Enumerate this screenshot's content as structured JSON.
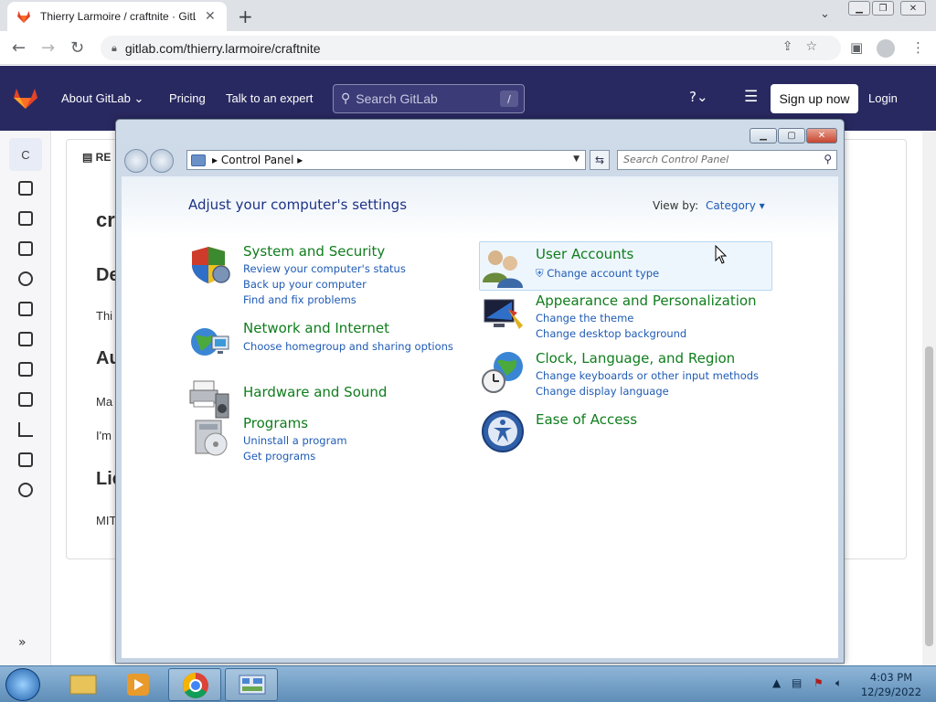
{
  "browser": {
    "tab_title": "Thierry Larmoire / craftnite · GitL",
    "url": "gitlab.com/thierry.larmoire/craftnite"
  },
  "gitlab": {
    "nav": {
      "about": "About GitLab",
      "pricing": "Pricing",
      "talk": "Talk to an expert",
      "search_placeholder": "Search GitLab",
      "search_shortcut": "/",
      "signup": "Sign up now",
      "login": "Login"
    },
    "project_avatar_letter": "C",
    "content_fragments": {
      "readme": "RE",
      "title": "cr",
      "h_description": "De",
      "p_description": "Thi",
      "h_authors": "Au",
      "p_authors_1": "Ma",
      "p_authors_2": "I'm",
      "h_license": "Lic",
      "p_license": "MIT"
    }
  },
  "control_panel": {
    "breadcrumb": "Control Panel",
    "search_placeholder": "Search Control Panel",
    "heading": "Adjust your computer's settings",
    "view_by_label": "View by:",
    "view_by_value": "Category",
    "categories_left": [
      {
        "title": "System and Security",
        "links": [
          "Review your computer's status",
          "Back up your computer",
          "Find and fix problems"
        ]
      },
      {
        "title": "Network and Internet",
        "links": [
          "Choose homegroup and sharing options"
        ]
      },
      {
        "title": "Hardware and Sound",
        "links": []
      },
      {
        "title": "Programs",
        "links": [
          "Uninstall a program",
          "Get programs"
        ]
      }
    ],
    "categories_right": [
      {
        "title": "User Accounts",
        "links": [
          "Change account type"
        ]
      },
      {
        "title": "Appearance and Personalization",
        "links": [
          "Change the theme",
          "Change desktop background"
        ]
      },
      {
        "title": "Clock, Language, and Region",
        "links": [
          "Change keyboards or other input methods",
          "Change display language"
        ]
      },
      {
        "title": "Ease of Access",
        "links": []
      }
    ]
  },
  "taskbar": {
    "time": "4:03 PM",
    "date": "12/29/2022"
  },
  "icons": {
    "tab_favicon": "gitlab-fox-icon",
    "window_close": "close-icon",
    "search": "magnifier-icon"
  }
}
